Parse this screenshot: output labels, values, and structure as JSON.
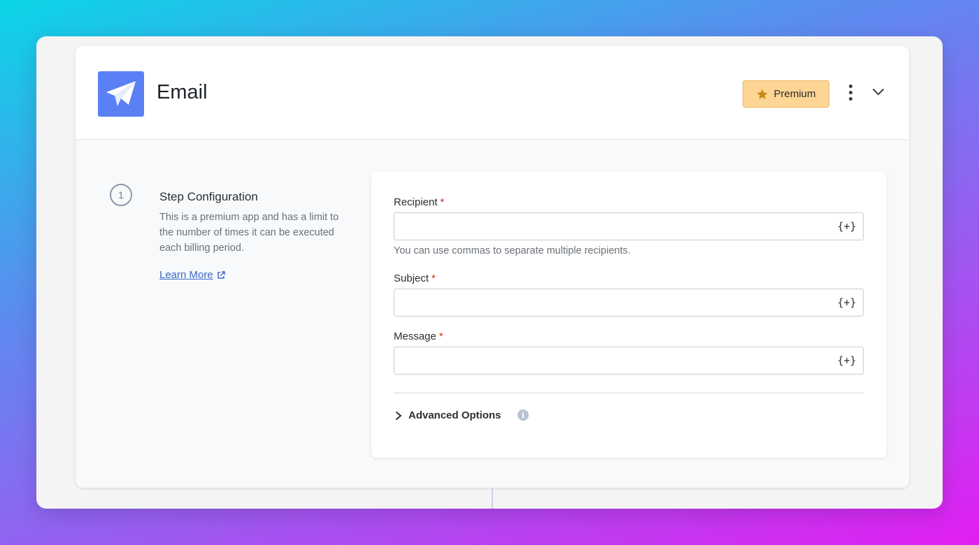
{
  "app": {
    "title": "Email",
    "icon": "paper-plane-icon",
    "brand_color": "#5b80f5"
  },
  "header": {
    "premium_label": "Premium",
    "premium_icon": "star-icon",
    "more_icon": "kebab-menu-icon",
    "collapse_icon": "chevron-down-icon"
  },
  "step": {
    "number": "1",
    "title": "Step Configuration",
    "description": "This is a premium app and has a limit to the number of times it can be executed each billing period.",
    "learn_more": "Learn More"
  },
  "form": {
    "recipient": {
      "label": "Recipient",
      "required": "*",
      "value": "",
      "var_button": "{+}",
      "help": "You can use commas to separate multiple recipients."
    },
    "subject": {
      "label": "Subject",
      "required": "*",
      "value": "",
      "var_button": "{+}"
    },
    "message": {
      "label": "Message",
      "required": "*",
      "value": "",
      "var_button": "{+}"
    },
    "advanced_label": "Advanced Options",
    "info_glyph": "i"
  }
}
